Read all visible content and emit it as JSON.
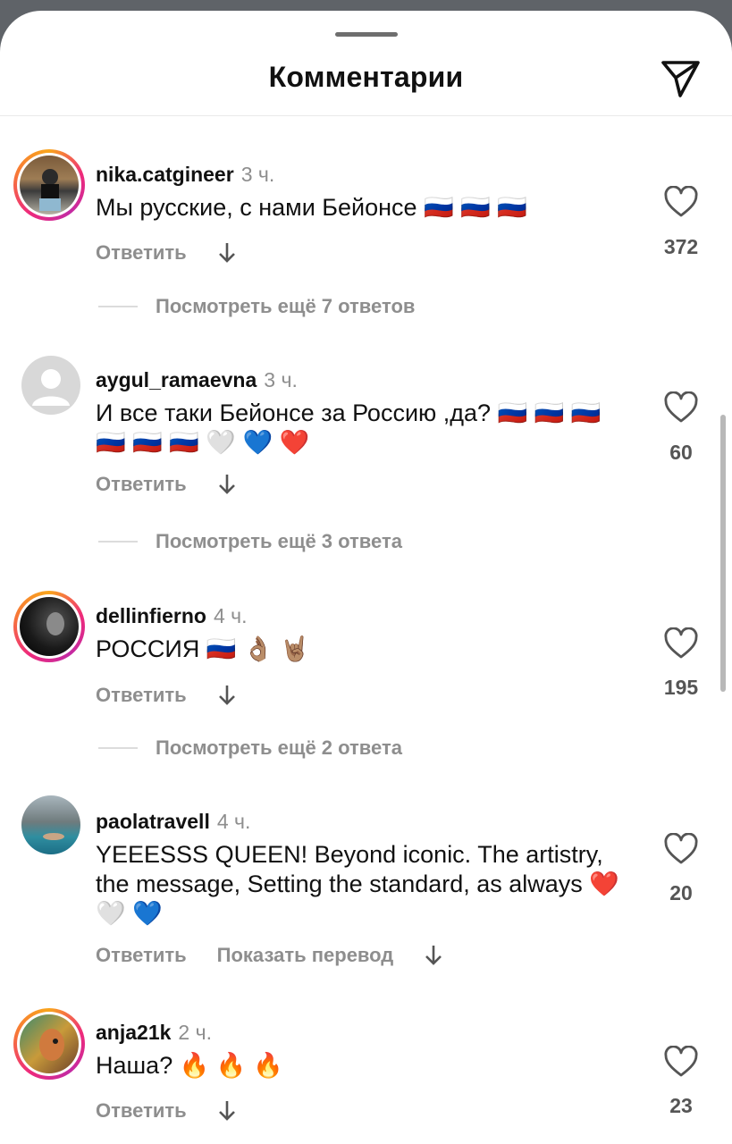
{
  "header": {
    "title": "Комментарии",
    "share_icon": "paper-plane-icon"
  },
  "comments": [
    {
      "username": "nika.catgineer",
      "time": "3 ч.",
      "text": "Мы русские, с нами Бейонсе 🇷🇺 🇷🇺 🇷🇺",
      "reply": "Ответить",
      "translate": "",
      "likes": "372",
      "more_replies": "Посмотреть ещё 7 ответов",
      "avatar_ring": true
    },
    {
      "username": "aygul_ramaevna",
      "time": "3 ч.",
      "text": "И все таки Бейонсе за Россию ,да? 🇷🇺 🇷🇺 🇷🇺 🇷🇺 🇷🇺 🇷🇺 🤍 💙 ❤️",
      "reply": "Ответить",
      "translate": "",
      "likes": "60",
      "more_replies": "Посмотреть ещё 3 ответа",
      "avatar_ring": false
    },
    {
      "username": "dellinfierno",
      "time": "4 ч.",
      "text": "РОССИЯ 🇷🇺 👌🏽 🤘🏽",
      "reply": "Ответить",
      "translate": "",
      "likes": "195",
      "more_replies": "Посмотреть ещё 2 ответа",
      "avatar_ring": true
    },
    {
      "username": "paolatravell",
      "time": "4 ч.",
      "text": "YEEESSS QUEEN! Beyond iconic. The artistry, the message, Setting the standard, as always ❤️ 🤍 💙",
      "reply": "Ответить",
      "translate": "Показать перевод",
      "likes": "20",
      "more_replies": "",
      "avatar_ring": false
    },
    {
      "username": "anja21k",
      "time": "2 ч.",
      "text": "Наша? 🔥 🔥 🔥",
      "reply": "Ответить",
      "translate": "",
      "likes": "23",
      "more_replies": "",
      "avatar_ring": true
    }
  ],
  "icons": {
    "like": "heart-outline-icon",
    "translate_arrow": "arrow-down-icon"
  },
  "colors": {
    "accent_ring_start": "#f9a51c",
    "accent_ring_end": "#c32aa3",
    "muted_text": "#8e8e8e"
  }
}
